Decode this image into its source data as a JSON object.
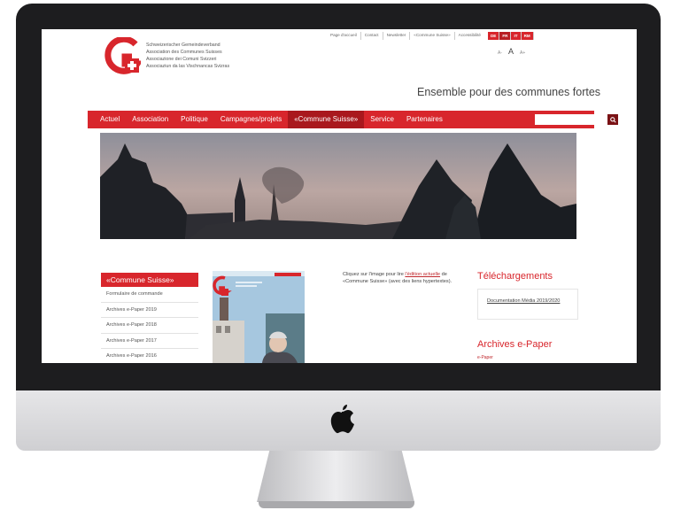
{
  "org_names": [
    "Schweizerischer Gemeindeverband",
    "Association des Communes Suisses",
    "Associazione dei Comuni Svizzeri",
    "Associaziun da las Vischnancas Svizras"
  ],
  "topnav": [
    "Page d'accueil",
    "Contact",
    "Newsletter",
    "«Commune Suisse»",
    "Accessibilité"
  ],
  "languages": [
    "DE",
    "FR",
    "IT",
    "RM"
  ],
  "active_language": "FR",
  "font_controls": [
    "A-",
    "A",
    "A+"
  ],
  "tagline": "Ensemble pour des communes fortes",
  "mainnav": [
    "Actuel",
    "Association",
    "Politique",
    "Campagnes/projets",
    "«Commune Suisse»",
    "Service",
    "Partenaires"
  ],
  "mainnav_active": "«Commune Suisse»",
  "search": {
    "placeholder": ""
  },
  "sidebar": {
    "title": "«Commune Suisse»",
    "items": [
      "Formulaire de commande",
      "Archives e-Paper 2019",
      "Archives e-Paper 2018",
      "Archives e-Paper 2017",
      "Archives e-Paper 2016"
    ]
  },
  "intro": {
    "before": "Cliquez sur l'image pour lire",
    "link": "l'édition actuelle",
    "after": "de «Commune Suisse» (avec des liens hypertextes)."
  },
  "downloads": {
    "title": "Téléchargements",
    "file": "Documentation Média 2019/2020"
  },
  "archives": {
    "title": "Archives e-Paper",
    "first": "e-Paper"
  },
  "colors": {
    "brand_red": "#d8262c",
    "active_nav": "#a9181d"
  }
}
